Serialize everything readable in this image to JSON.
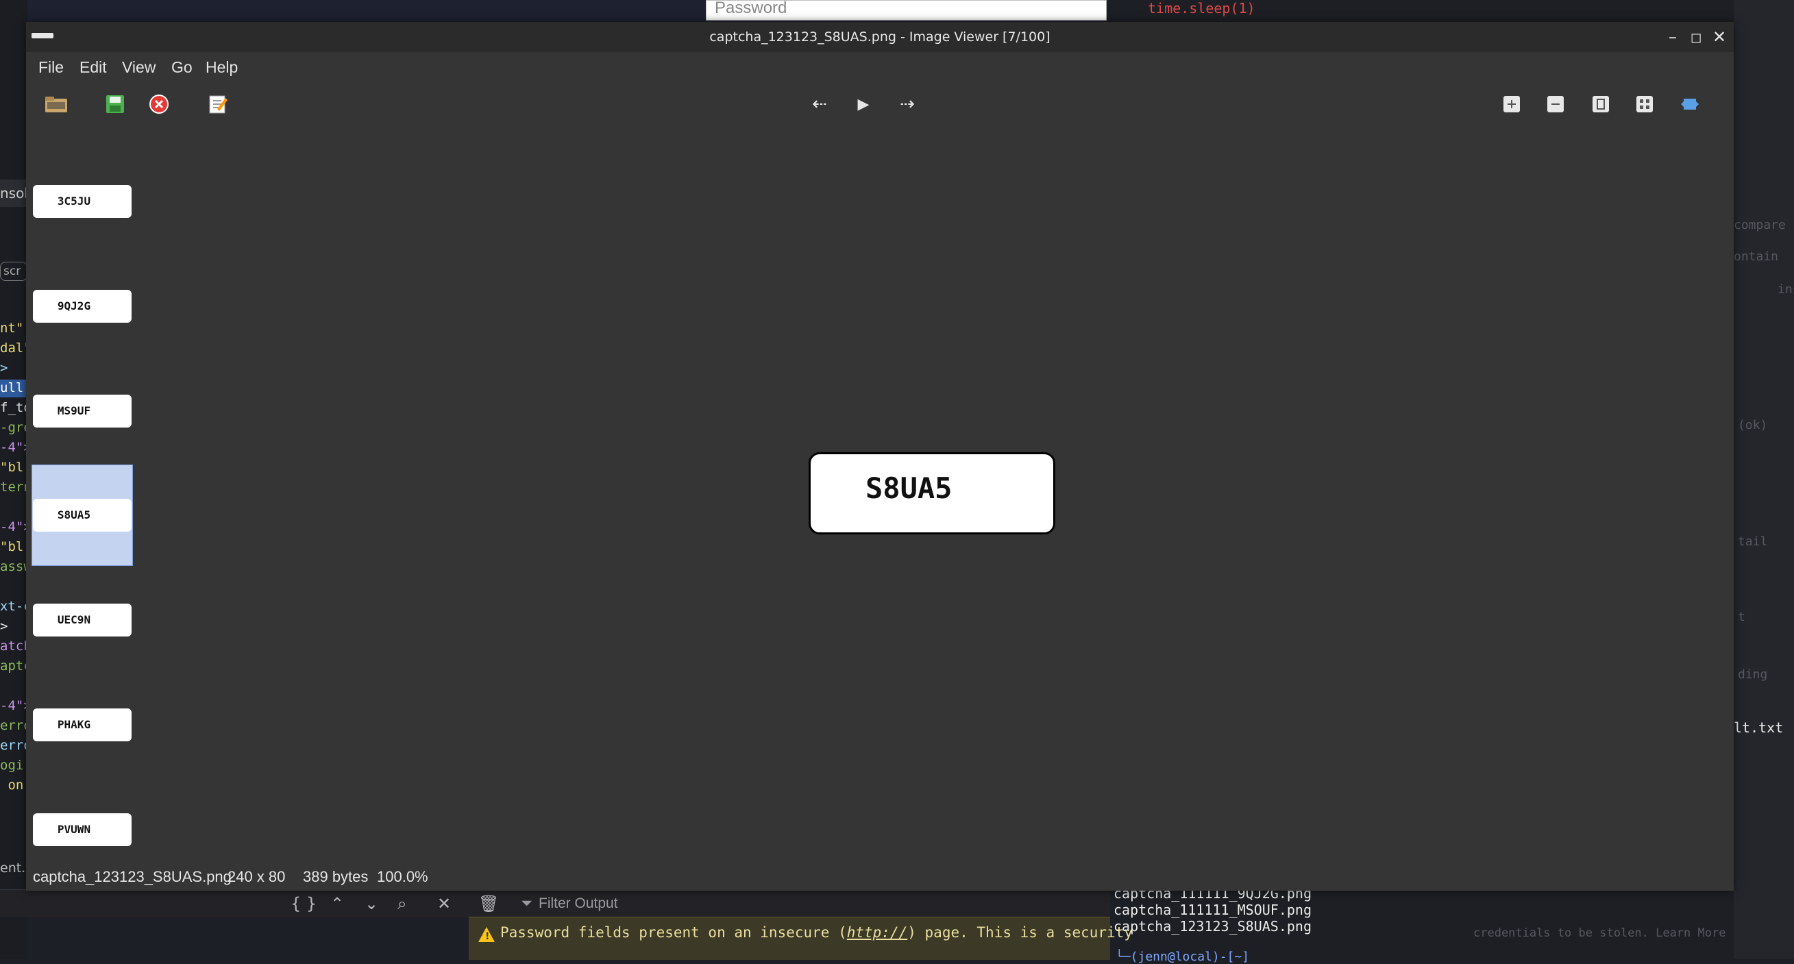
{
  "background": {
    "password_placeholder": "Password",
    "terminal_top_line": "time.sleep(1)",
    "left_panel_tab": "nsol",
    "left_panel_pill": "scr",
    "left_code_lines": [
      {
        "text": "nt\"",
        "color": "#e6db74"
      },
      {
        "text": "dal\"",
        "color": "#e6db74"
      },
      {
        "text": ">",
        "color": "#9cdcfe"
      },
      {
        "text": "ull",
        "color": "#ffffff"
      },
      {
        "text": "f_to",
        "color": "#e6e6e6"
      },
      {
        "text": "-gre",
        "color": "#8fbc5a"
      },
      {
        "text": "-4\">",
        "color": "#c792ea"
      },
      {
        "text": "\"bl",
        "color": "#e6db74"
      },
      {
        "text": "tern",
        "color": "#8fbc5a"
      },
      {
        "text": "",
        "color": "#e6e6e6"
      },
      {
        "text": "-4\">",
        "color": "#c792ea"
      },
      {
        "text": "\"bl",
        "color": "#e6db74"
      },
      {
        "text": "assw",
        "color": "#8fbc5a"
      },
      {
        "text": "",
        "color": "#e6e6e6"
      },
      {
        "text": "xt-c",
        "color": "#9cdcfe"
      },
      {
        "text": ">",
        "color": "#e6e6e6"
      },
      {
        "text": "atch",
        "color": "#c792ea"
      },
      {
        "text": "aptc",
        "color": "#8fbc5a"
      },
      {
        "text": "",
        "color": "#e6e6e6"
      },
      {
        "text": "-4\">",
        "color": "#c792ea"
      },
      {
        "text": "erro",
        "color": "#8fbc5a"
      },
      {
        "text": "erro",
        "color": "#9cdcfe"
      },
      {
        "text": "ogi",
        "color": "#8fbc5a"
      },
      {
        "text": " on",
        "color": "#e6db74"
      }
    ],
    "left_file_label": "ent.v",
    "right_ghost_lines": [
      "compare",
      "ontain",
      "ins",
      "(ok)",
      "tail",
      "t",
      "ding"
    ],
    "right_terminal_fragment": "lt.txt",
    "terminal_file_lines": [
      "captcha_111111_9QJ2G.png",
      "captcha_111111_MSOUF.png",
      "captcha_123123_S8UAS.png"
    ],
    "terminal_prompt": "└─(jenn@local)-[~]",
    "ghost_warning_tail": "credentials to be stolen. Learn More"
  },
  "devtools": {
    "filter_placeholder": "Filter Output",
    "warning_text": "Password fields present on an insecure (",
    "warning_link": "http://",
    "warning_text_after": ") page. This is a security"
  },
  "viewer": {
    "title": "captcha_123123_S8UAS.png - Image Viewer [7/100]",
    "menu": [
      "File",
      "Edit",
      "View",
      "Go",
      "Help"
    ],
    "thumbnails": [
      {
        "label": "3C5JU"
      },
      {
        "label": "9QJ2G"
      },
      {
        "label": "MS9UF"
      },
      {
        "label": "S8UA5"
      },
      {
        "label": "UEC9N"
      },
      {
        "label": "PHAKG"
      },
      {
        "label": "PVUWN"
      }
    ],
    "selected_index": 3,
    "main_image_text": "S8UA5",
    "status": {
      "filename": "captcha_123123_S8UAS.png",
      "dimensions": "240 x 80",
      "size": "389 bytes",
      "zoom": "100.0%"
    }
  },
  "colors": {
    "window_bg": "#353535",
    "selection": "#c4d3ef",
    "warning_bg": "#3c3a26"
  }
}
